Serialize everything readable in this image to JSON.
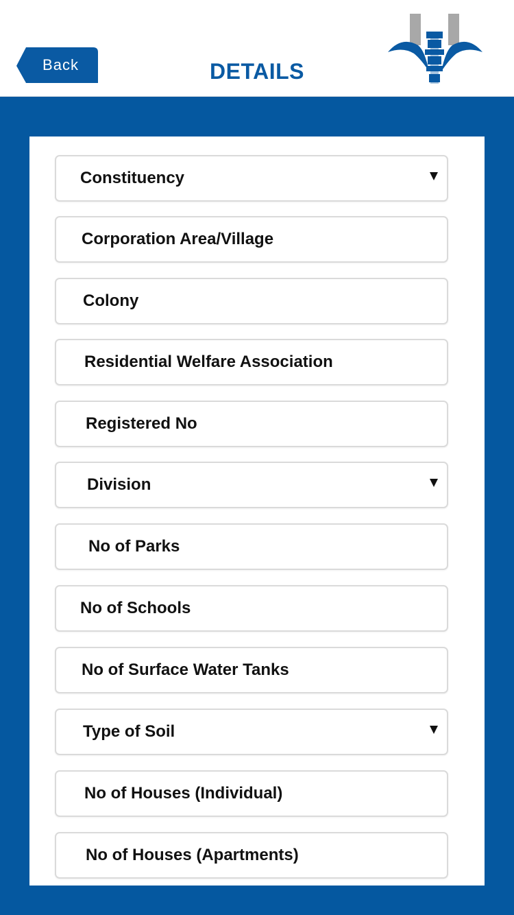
{
  "header": {
    "back_label": "Back",
    "title": "DETAILS",
    "logo_icon": "water-board-logo-icon"
  },
  "colors": {
    "brand_blue": "#0558a0",
    "title_blue": "#0a5aa3",
    "logo_gray": "#a8a8a8"
  },
  "form": {
    "fields": [
      {
        "label": "Constituency",
        "type": "dropdown"
      },
      {
        "label": "Corporation Area/Village",
        "type": "text"
      },
      {
        "label": "Colony",
        "type": "text"
      },
      {
        "label": "Residential Welfare Association",
        "type": "text"
      },
      {
        "label": "Registered No",
        "type": "text"
      },
      {
        "label": "Division",
        "type": "dropdown"
      },
      {
        "label": "No of Parks",
        "type": "text"
      },
      {
        "label": "No of Schools",
        "type": "text"
      },
      {
        "label": "No of Surface Water Tanks",
        "type": "text"
      },
      {
        "label": "Type of Soil",
        "type": "dropdown"
      },
      {
        "label": "No of Houses (Individual)",
        "type": "text"
      },
      {
        "label": "No of Houses (Apartments)",
        "type": "text"
      }
    ]
  }
}
